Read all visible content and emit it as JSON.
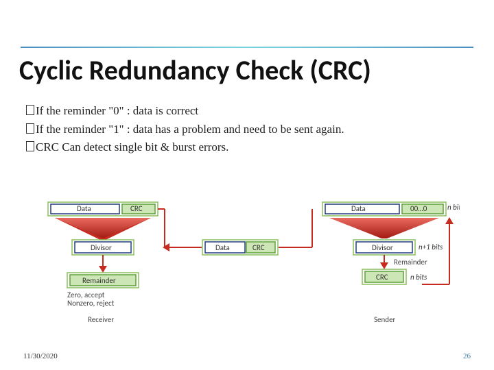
{
  "title": "Cyclic Redundancy Check (CRC)",
  "bullets": {
    "b1": "If the reminder \"0\" : data is correct",
    "b2": "If the reminder \"1\" : data has a problem and need to be sent again.",
    "b3": "CRC Can detect single bit & burst errors."
  },
  "diagram": {
    "receiver": {
      "data": "Data",
      "crc": "CRC",
      "divisor": "Divisor",
      "remainder": "Remainder",
      "note1": "Zero, accept",
      "note2": "Nonzero, reject",
      "label": "Receiver"
    },
    "sender": {
      "data": "Data",
      "zeros": "00…0",
      "nbits": "n bits",
      "divisor": "Divisor",
      "np1": "n+1 bits",
      "remainder": "Remainder",
      "crc": "CRC",
      "nbits2": "n bits",
      "label": "Sender"
    },
    "mid_data": "Data",
    "mid_crc": "CRC"
  },
  "footer": {
    "date": "11/30/2020",
    "num": "26"
  }
}
